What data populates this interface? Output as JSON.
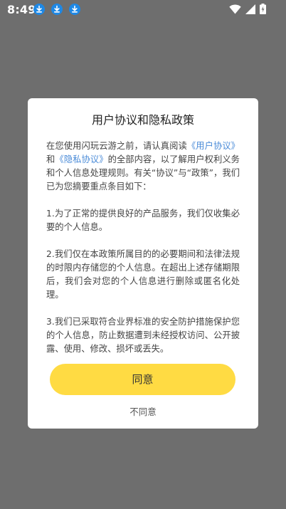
{
  "status_bar": {
    "time": "8:49",
    "download_icons": [
      "download-icon",
      "download-icon",
      "download-icon"
    ],
    "right_icons": [
      "wifi-icon",
      "cellular-signal-icon",
      "battery-charging-icon"
    ]
  },
  "dialog": {
    "title": "用户协议和隐私政策",
    "intro": {
      "before_link1": "在您使用闪玩云游之前，请认真阅读",
      "link1": "《用户协议》",
      "and": "和",
      "link2": "《隐私协议》",
      "after_links": "的全部内容，以了解用户权利义务和个人信息处理规则。有关“协议”与“政策”，我们已为您摘要重点条目如下："
    },
    "points": [
      "1.为了正常的提供良好的产品服务，我们仅收集必要的个人信息。",
      "2.我们仅在本政策所属目的的必要期间和法律法规的时限内存储您的个人信息。在超出上述存储期限后，我们会对您的个人信息进行删除或匿名化处理。",
      "3.我们已采取符合业界标准的安全防护措施保护您的个人信息，防止数据遭到未经授权访问、公开披露、使用、修改、损坏或丢失。"
    ],
    "agree_label": "同意",
    "disagree_label": "不同意"
  },
  "colors": {
    "overlay": "#6e6e6e",
    "dialog_bg": "#ffffff",
    "link": "#4a8bd8",
    "agree_button": "#ffdb43"
  }
}
